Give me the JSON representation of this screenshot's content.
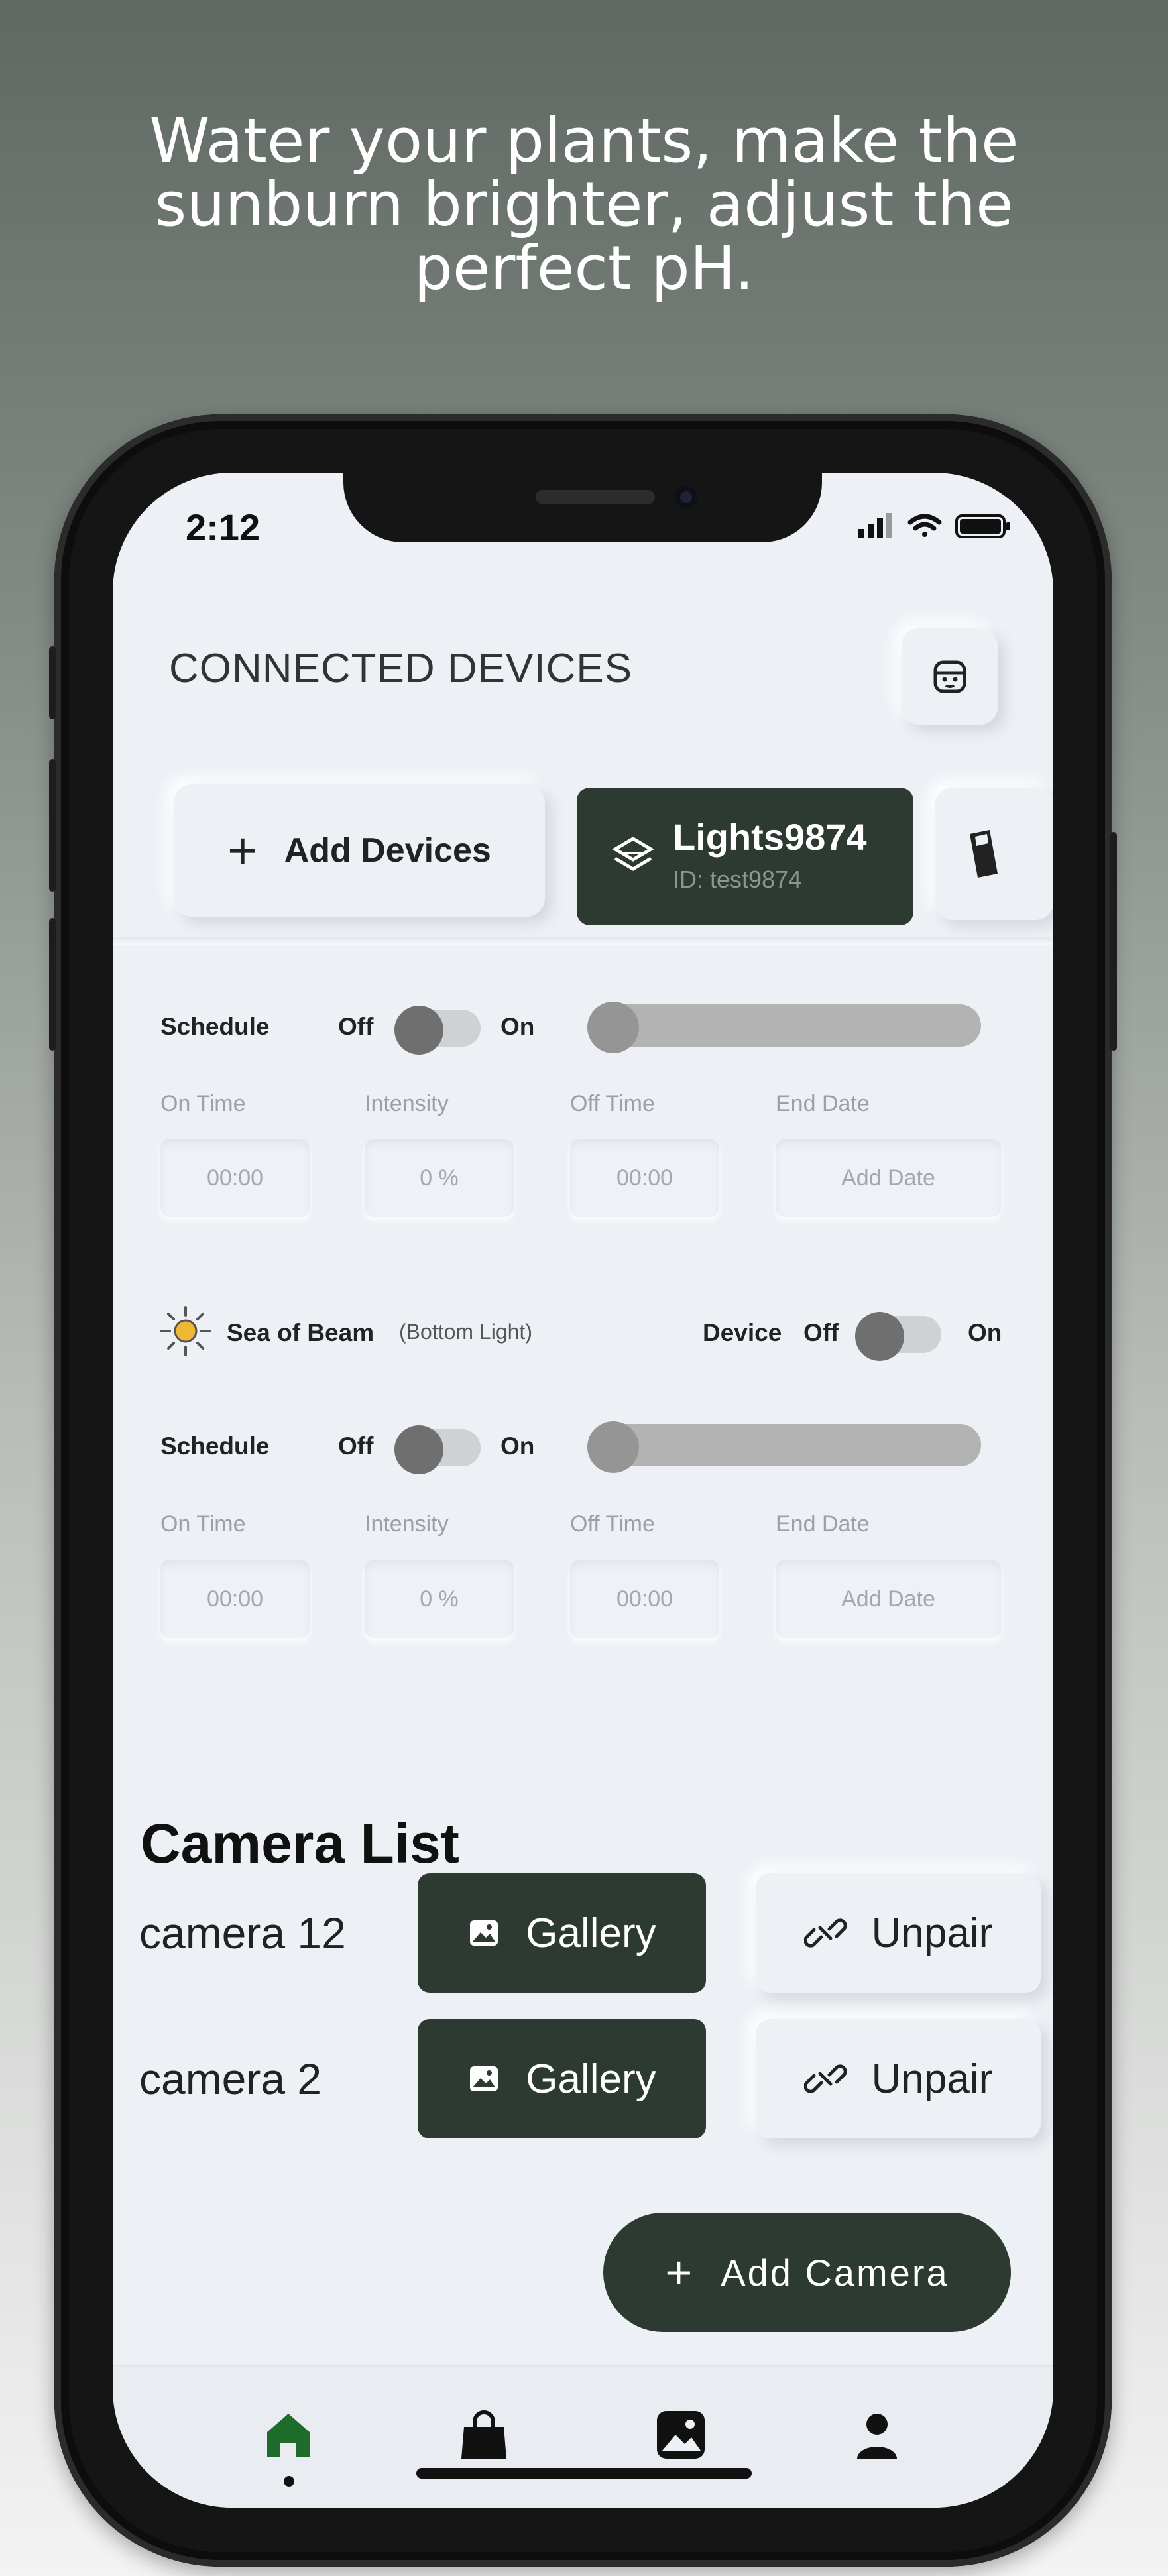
{
  "headline": {
    "line1": "Water your plants, make the",
    "line2": "sunburn brighter, adjust the",
    "line3": "perfect pH."
  },
  "status_bar": {
    "time": "2:12",
    "icons": [
      "signal-icon",
      "wifi-icon",
      "battery-icon"
    ]
  },
  "header": {
    "title": "CONNECTED DEVICES",
    "profile_icon": "robot-face-icon"
  },
  "devices": {
    "add_label": "Add Devices",
    "selected": {
      "name": "Lights9874",
      "id": "ID: test9874",
      "icon": "light-panel-icon"
    },
    "next_icon": "device-icon"
  },
  "light_section_1": {
    "schedule_label": "Schedule",
    "off_label": "Off",
    "on_label": "On",
    "schedule_on": false,
    "intensity_level": 0,
    "fields": [
      {
        "label": "On Time",
        "value": "00:00"
      },
      {
        "label": "Intensity",
        "value": "0 %"
      },
      {
        "label": "Off Time",
        "value": "00:00"
      },
      {
        "label": "End Date",
        "value": "Add Date"
      }
    ]
  },
  "light_section_2": {
    "name": "Sea of Beam",
    "subtitle": "(Bottom Light)",
    "device_label": "Device",
    "device_off_label": "Off",
    "device_on_label": "On",
    "device_on": false,
    "schedule_label": "Schedule",
    "off_label": "Off",
    "on_label": "On",
    "schedule_on": false,
    "intensity_level": 0,
    "fields": [
      {
        "label": "On Time",
        "value": "00:00"
      },
      {
        "label": "Intensity",
        "value": "0 %"
      },
      {
        "label": "Off Time",
        "value": "00:00"
      },
      {
        "label": "End Date",
        "value": "Add Date"
      }
    ]
  },
  "camera_list": {
    "title": "Camera List",
    "cameras": [
      {
        "name": "camera 12",
        "gallery_label": "Gallery",
        "unpair_label": "Unpair"
      },
      {
        "name": "camera 2",
        "gallery_label": "Gallery",
        "unpair_label": "Unpair"
      }
    ],
    "add_label": "Add Camera"
  },
  "tab_bar": {
    "tabs": [
      "home-icon",
      "bag-icon",
      "image-icon",
      "user-icon"
    ],
    "active": "home-icon"
  },
  "colors": {
    "accent": "#2d3a32",
    "active_tab": "#1f6b2a",
    "screen_bg": "#edf1f6"
  }
}
